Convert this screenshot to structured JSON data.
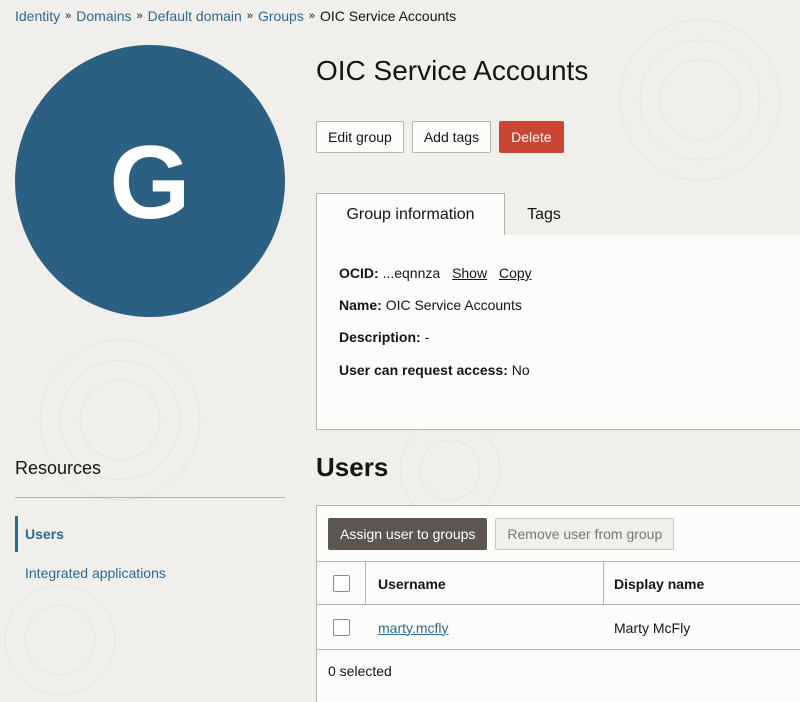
{
  "breadcrumb": {
    "items": [
      "Identity",
      "Domains",
      "Default domain",
      "Groups"
    ],
    "current": "OIC Service Accounts",
    "separator": "»"
  },
  "avatar": {
    "letter": "G",
    "color": "#2c6083"
  },
  "page": {
    "title": "OIC Service Accounts"
  },
  "actions": {
    "edit": "Edit group",
    "add_tags": "Add tags",
    "delete": "Delete"
  },
  "tabs": {
    "info": "Group information",
    "tags": "Tags"
  },
  "info": {
    "ocid_label": "OCID:",
    "ocid_value": "...eqnnza",
    "show": "Show",
    "copy": "Copy",
    "name_label": "Name:",
    "name_value": "OIC Service Accounts",
    "description_label": "Description:",
    "description_value": "-",
    "request_label": "User can request access:",
    "request_value": "No"
  },
  "resources": {
    "title": "Resources",
    "items": [
      "Users",
      "Integrated applications"
    ]
  },
  "users": {
    "title": "Users",
    "assign_button": "Assign user to groups",
    "remove_button": "Remove user from group",
    "columns": [
      "Username",
      "Display name"
    ],
    "rows": [
      {
        "username": "marty.mcfly",
        "display_name": "Marty McFly"
      }
    ],
    "selected_text": "0 selected"
  },
  "colors": {
    "accent": "#2b6a8f",
    "danger": "#c74634",
    "primary_dark": "#5b5652"
  }
}
